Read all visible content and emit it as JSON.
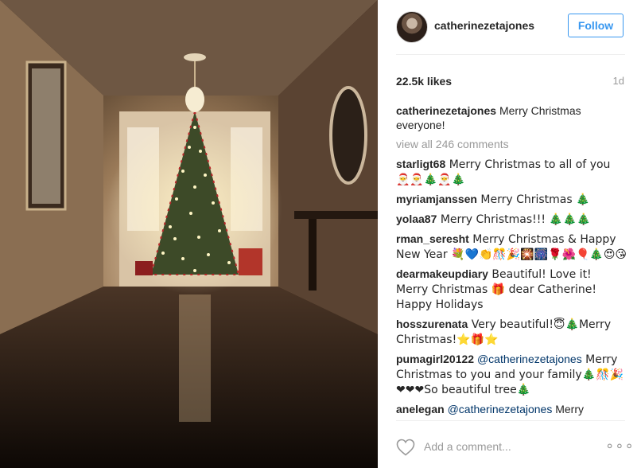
{
  "post": {
    "username": "catherinezetajones",
    "follow_label": "Follow",
    "likes": "22.5k likes",
    "age": "1d",
    "caption_user": "catherinezetajones",
    "caption_text": " Merry Christmas everyone!",
    "view_all": "view all 246 comments",
    "add_comment_placeholder": "Add a comment...",
    "more_label": "∘∘∘"
  },
  "comments": [
    {
      "user": "starligt68",
      "text": " Merry Christmas to all of you 🎅🎅🎄🎅🎄"
    },
    {
      "user": "myriamjanssen",
      "text": " Merry Christmas 🎄"
    },
    {
      "user": "yolaa87",
      "text": " Merry Christmas!!! 🎄🎄🎄"
    },
    {
      "user": "rman_seresht",
      "text": " Merry Christmas & Happy New Year 💐💙👏🎊🎉🎇🎆🌹🌺🎈🎄😍😘"
    },
    {
      "user": "dearmakeupdiary",
      "text": " Beautiful! Love it! Merry Christmas 🎁 dear Catherine! Happy Holidays"
    },
    {
      "user": "hosszurenata",
      "text": " Very beautiful!😇🎄Merry Christmas!⭐🎁⭐"
    },
    {
      "user": "pumagirl20122",
      "mention": "@catherinezetajones",
      "text": " Merry Christmas to you and your family🎄🎊🎉❤❤❤So beautiful tree🎄"
    },
    {
      "user": "anelegan",
      "mention": "@catherinezetajones",
      "text": " Merry"
    }
  ],
  "colors": {
    "accent": "#3897f0",
    "mention": "#003569",
    "muted": "#999999",
    "text": "#262626"
  },
  "icons": [
    "heart-icon",
    "more-options-icon"
  ]
}
